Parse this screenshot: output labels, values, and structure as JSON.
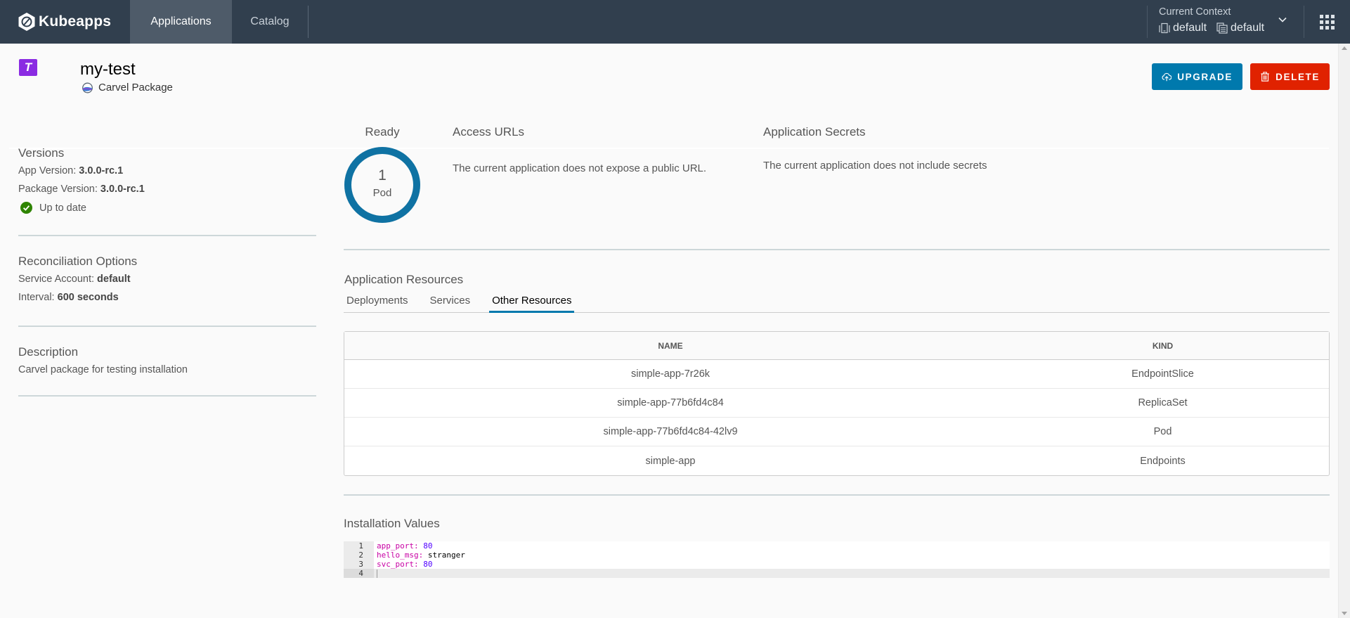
{
  "nav": {
    "brand": "Kubeapps",
    "items": [
      {
        "label": "Applications",
        "active": true
      },
      {
        "label": "Catalog",
        "active": false
      }
    ],
    "context": {
      "label": "Current Context",
      "cluster": "default",
      "namespace": "default"
    }
  },
  "app": {
    "icon_letter": "T",
    "icon_color": "#8a2be2",
    "name": "my-test",
    "package_type": "Carvel Package",
    "actions": {
      "upgrade": "UPGRADE",
      "delete": "DELETE"
    }
  },
  "sidebar": {
    "versions": {
      "title": "Versions",
      "app_version_label": "App Version:",
      "app_version": "3.0.0-rc.1",
      "package_version_label": "Package Version:",
      "package_version": "3.0.0-rc.1",
      "status": "Up to date"
    },
    "reconciliation": {
      "title": "Reconciliation Options",
      "service_account_label": "Service Account:",
      "service_account": "default",
      "interval_label": "Interval:",
      "interval": "600 seconds"
    },
    "description": {
      "title": "Description",
      "text": "Carvel package for testing installation"
    }
  },
  "summary": {
    "ready": {
      "title": "Ready",
      "count": "1",
      "unit": "Pod",
      "ready_fraction": 1.0
    },
    "access_urls": {
      "title": "Access URLs",
      "message": "The current application does not expose a public URL."
    },
    "secrets": {
      "title": "Application Secrets",
      "message": "The current application does not include secrets"
    }
  },
  "resources": {
    "title": "Application Resources",
    "tabs": [
      {
        "label": "Deployments",
        "active": false
      },
      {
        "label": "Services",
        "active": false
      },
      {
        "label": "Other Resources",
        "active": true
      }
    ],
    "columns": [
      "NAME",
      "KIND"
    ],
    "rows": [
      {
        "name": "simple-app-7r26k",
        "kind": "EndpointSlice"
      },
      {
        "name": "simple-app-77b6fd4c84",
        "kind": "ReplicaSet"
      },
      {
        "name": "simple-app-77b6fd4c84-42lv9",
        "kind": "Pod"
      },
      {
        "name": "simple-app",
        "kind": "Endpoints"
      }
    ]
  },
  "values": {
    "title": "Installation Values",
    "lines": [
      {
        "num": "1",
        "key": "app_port",
        "value": "80",
        "type": "number"
      },
      {
        "num": "2",
        "key": "hello_msg",
        "value": "stranger",
        "type": "string"
      },
      {
        "num": "3",
        "key": "svc_port",
        "value": "80",
        "type": "number"
      },
      {
        "num": "4",
        "key": "",
        "value": "",
        "type": "empty"
      }
    ]
  },
  "colors": {
    "header_bg": "#313f4e",
    "primary": "#0079ad",
    "danger": "#e02200",
    "success": "#2f8400"
  }
}
